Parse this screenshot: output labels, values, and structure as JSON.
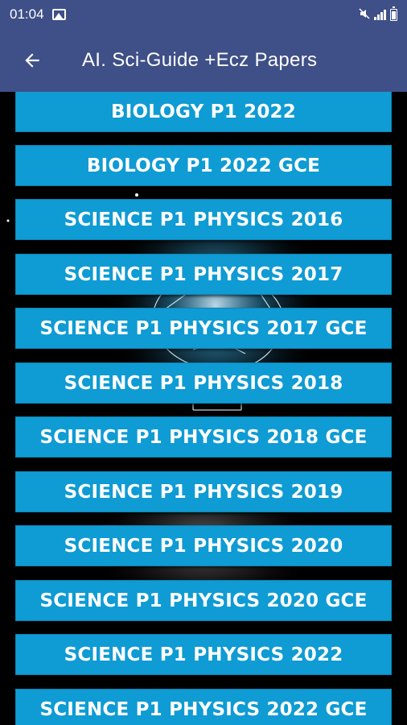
{
  "status_bar": {
    "time": "01:04",
    "icons": [
      "gallery-icon",
      "mute-icon",
      "signal-icon",
      "battery-icon"
    ]
  },
  "app_bar": {
    "title": "AI. Sci-Guide +Ecz Papers",
    "back_icon": "arrow-left-icon"
  },
  "colors": {
    "app_bar": "#3f4f87",
    "button": "#0f9bd3",
    "background": "#000000"
  },
  "papers": [
    "BIOLOGY P1 2022",
    "BIOLOGY P1 2022 GCE",
    "SCIENCE P1 PHYSICS 2016",
    "SCIENCE P1 PHYSICS 2017",
    "SCIENCE P1 PHYSICS 2017 GCE",
    "SCIENCE P1 PHYSICS 2018",
    "SCIENCE P1 PHYSICS 2018 GCE",
    "SCIENCE P1 PHYSICS 2019",
    "SCIENCE P1 PHYSICS 2020",
    "SCIENCE P1 PHYSICS 2020 GCE",
    "SCIENCE P1 PHYSICS 2022",
    "SCIENCE P1 PHYSICS 2022 GCE"
  ]
}
